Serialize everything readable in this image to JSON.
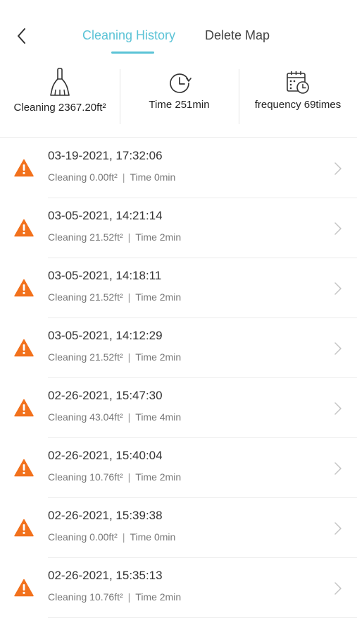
{
  "header": {
    "back_icon": "chevron-left-icon",
    "tab_active_label": "Cleaning History",
    "tab_inactive_label": "Delete Map",
    "accent_color": "#5bc3d6"
  },
  "stats": {
    "area": {
      "icon": "broom-icon",
      "text": "Cleaning 2367.20ft²"
    },
    "time": {
      "icon": "clock-icon",
      "text": "Time 251min"
    },
    "frequency": {
      "icon": "calendar-clock-icon",
      "text": "frequency 69times"
    }
  },
  "records": [
    {
      "datetime": "03-19-2021, 17:32:06",
      "area": "Cleaning 0.00ft²",
      "time": "Time 0min"
    },
    {
      "datetime": "03-05-2021, 14:21:14",
      "area": "Cleaning 21.52ft²",
      "time": "Time 2min"
    },
    {
      "datetime": "03-05-2021, 14:18:11",
      "area": "Cleaning 21.52ft²",
      "time": "Time 2min"
    },
    {
      "datetime": "03-05-2021, 14:12:29",
      "area": "Cleaning 21.52ft²",
      "time": "Time 2min"
    },
    {
      "datetime": "02-26-2021, 15:47:30",
      "area": "Cleaning 43.04ft²",
      "time": "Time 4min"
    },
    {
      "datetime": "02-26-2021, 15:40:04",
      "area": "Cleaning 10.76ft²",
      "time": "Time 2min"
    },
    {
      "datetime": "02-26-2021, 15:39:38",
      "area": "Cleaning 0.00ft²",
      "time": "Time 0min"
    },
    {
      "datetime": "02-26-2021, 15:35:13",
      "area": "Cleaning 10.76ft²",
      "time": "Time 2min"
    }
  ],
  "record_status_icon": "warning-icon",
  "record_status_color": "#f2711c",
  "separator": "|"
}
